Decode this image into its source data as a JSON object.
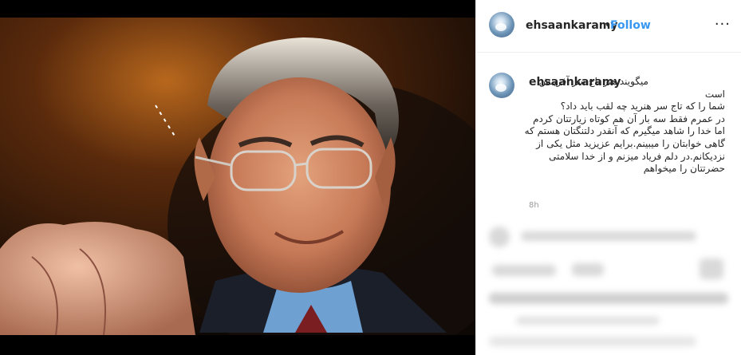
{
  "post": {
    "username": "ehsaankaramy",
    "follow_label": "Follow",
    "separator": "•",
    "more_label": "···"
  },
  "caption": {
    "username": "ehsaankaramy",
    "text": "میگویند هنر تاج سر آفرینش است\nشما را که تاج سر هنرید چه لقب باید داد؟\nدر عمرم فقط سه بار آن هم کوتاه زیارتتان کردم اما خدا را شاهد میگیرم که آنقدر دلتنگتان هستم که گاهی خوابتان را میبینم.برایم عزیزید مثل یکی از نزدیکانم.در دلم فریاد میزنم و از خدا سلامتی حضرتتان را میخواهم",
    "time": "8h"
  },
  "colors": {
    "link": "#3897f0",
    "text": "#262626",
    "muted": "#999999",
    "divider": "#efefef"
  }
}
